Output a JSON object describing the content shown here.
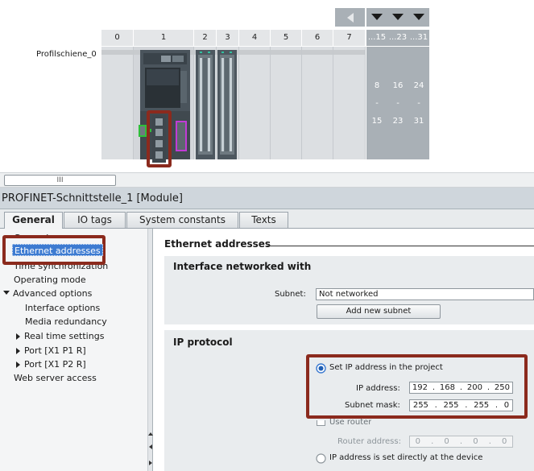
{
  "rack": {
    "rail_label": "Profilschiene_0",
    "slots": [
      "0",
      "1",
      "2",
      "3",
      "4",
      "5",
      "6",
      "7"
    ],
    "extra_slots": [
      "...15",
      "...23",
      "...31"
    ],
    "col_ranges": [
      {
        "from": "8",
        "dash": "-",
        "to": "15"
      },
      {
        "from": "16",
        "dash": "-",
        "to": "23"
      },
      {
        "from": "24",
        "dash": "-",
        "to": "31"
      }
    ]
  },
  "scrollbar": {
    "thumb_glyph": "III"
  },
  "module_title": "PROFINET-Schnittstelle_1 [Module]",
  "tabs": [
    "General",
    "IO tags",
    "System constants",
    "Texts"
  ],
  "nav": {
    "items": [
      {
        "label": "General"
      },
      {
        "label": "Ethernet addresses"
      },
      {
        "label": "Time synchronization"
      },
      {
        "label": "Operating mode"
      },
      {
        "label": "Advanced options"
      },
      {
        "label": "Interface options"
      },
      {
        "label": "Media redundancy"
      },
      {
        "label": "Real time settings"
      },
      {
        "label": "Port [X1 P1 R]"
      },
      {
        "label": "Port [X1 P2 R]"
      },
      {
        "label": "Web server access"
      }
    ]
  },
  "content": {
    "title": "Ethernet addresses",
    "interface": {
      "heading": "Interface networked with",
      "subnet_label": "Subnet:",
      "subnet_value": "Not networked",
      "add_subnet_button": "Add new subnet"
    },
    "ip": {
      "heading": "IP protocol",
      "set_ip_label": "Set IP address in the project",
      "ip_label": "IP address:",
      "ip_octets": [
        "192",
        "168",
        "200",
        "250"
      ],
      "mask_label": "Subnet mask:",
      "mask_octets": [
        "255",
        "255",
        "255",
        "0"
      ],
      "use_router_label": "Use router",
      "router_label": "Router address:",
      "router_octets": [
        "0",
        "0",
        "0",
        "0"
      ],
      "direct_label": "IP address is set directly at the device"
    }
  },
  "colors": {
    "highlight_red": "#8b2a1d",
    "magenta": "#c23bd6",
    "green": "#2fbf3a",
    "selection": "#3d7bd1"
  }
}
